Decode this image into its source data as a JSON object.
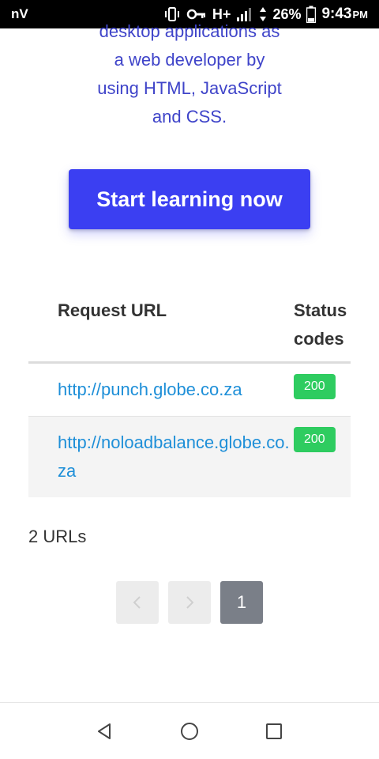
{
  "status_bar": {
    "carrier": "nV",
    "network": "H+",
    "battery": "26%",
    "time": "9:43",
    "ampm": "PM",
    "icons": [
      "vibrate-icon",
      "key-icon",
      "signal-icon",
      "data-arrows-icon",
      "battery-icon"
    ]
  },
  "hero": {
    "line1": "desktop applications as",
    "line2": "a web developer by",
    "line3": "using HTML, JavaScript",
    "line4": "and CSS.",
    "text_color": "#3f44c9"
  },
  "cta": {
    "label": "Start learning now",
    "color": "#3b3ff2"
  },
  "table": {
    "headers": {
      "url_line1": "Request URL",
      "status_line1": "Status",
      "status_line2": "codes"
    },
    "rows": [
      {
        "url": "http://punch.globe.co.za",
        "status": "200"
      },
      {
        "url": "http://noloadbalance.globe.co.za",
        "status": "200"
      }
    ],
    "link_color": "#1e8fd8",
    "badge_color": "#2ecc60"
  },
  "summary": {
    "count_text": "2 URLs"
  },
  "pagination": {
    "prev_icon": "chevron-left-icon",
    "next_icon": "chevron-right-icon",
    "current_page": "1"
  },
  "nav_bar": {
    "icons": [
      "back-triangle-icon",
      "home-circle-icon",
      "recents-square-icon"
    ]
  }
}
